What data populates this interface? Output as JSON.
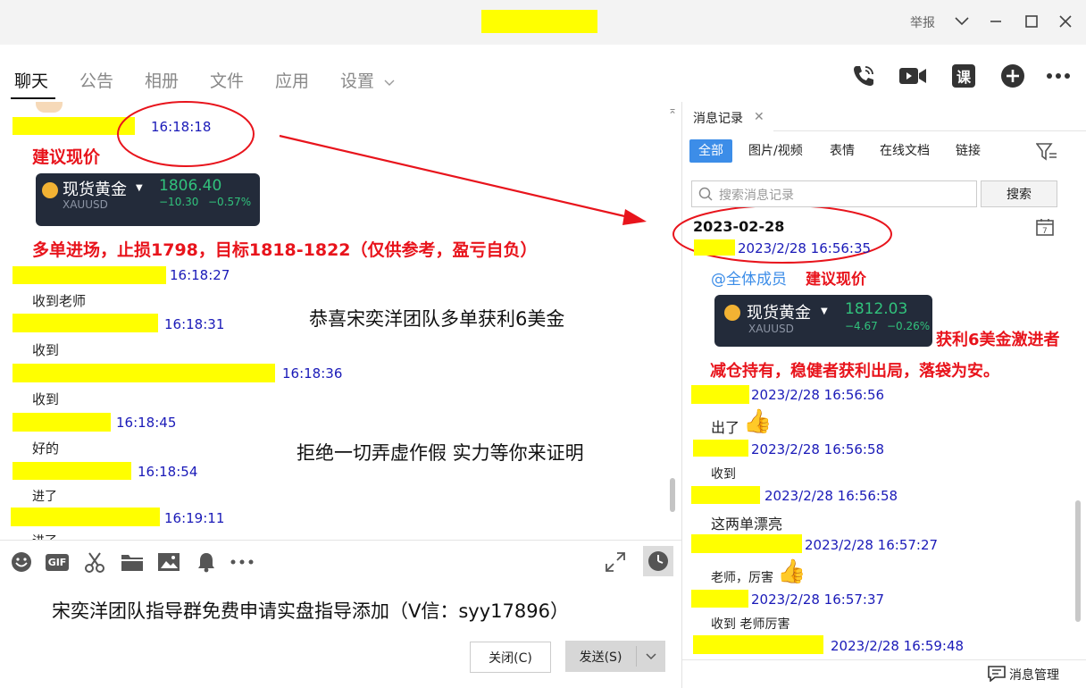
{
  "titlebar": {
    "report_label": "举报"
  },
  "tabs": [
    "聊天",
    "公告",
    "相册",
    "文件",
    "应用",
    "设置"
  ],
  "toolbar_right": {
    "lesson_label": "课"
  },
  "chat": {
    "msgs": [
      {
        "time": "16:18:18"
      },
      {
        "time": "16:18:27",
        "text": "收到老师"
      },
      {
        "time": "16:18:31",
        "text": "收到"
      },
      {
        "time": "16:18:36",
        "text": "收到"
      },
      {
        "time": "16:18:45",
        "text": "好的"
      },
      {
        "time": "16:18:54",
        "text": "进了"
      },
      {
        "time": "16:19:11",
        "text": "进了"
      }
    ],
    "suggest": "建议现价",
    "quote": {
      "name": "现货黄金",
      "price": "1806.40",
      "change": "−10.30",
      "pct": "−0.57%",
      "symbol": "XAUUSD"
    },
    "trade_note": "多单进场，止损1798，目标1818-1822（仅供参考，盈亏自负）",
    "overlay1": "恭喜宋奕洋团队多单获利6美金",
    "overlay2": "拒绝一切弄虚作假 实力等你来证明"
  },
  "composer": {
    "text": "宋奕洋团队指导群免费申请实盘指导添加（V信：syy17896）",
    "close_label": "关闭(C)",
    "send_label": "发送(S)"
  },
  "history": {
    "tab_label": "消息记录",
    "filters": [
      "全部",
      "图片/视频",
      "表情",
      "在线文档",
      "链接"
    ],
    "search_placeholder": "搜索消息记录",
    "search_button": "搜索",
    "date": "2023-02-28",
    "first_time": "2023/2/28 16:56:35",
    "mention": "@全体成员",
    "suggest": "建议现价",
    "quote": {
      "name": "现货黄金",
      "price": "1812.03",
      "change": "−4.67",
      "pct": "−0.26%",
      "symbol": "XAUUSD"
    },
    "profit_note1": "获利6美金激进者",
    "profit_note2": "减仓持有，稳健者获利出局，落袋为安。",
    "entries": [
      {
        "time": "2023/2/28 16:56:56",
        "text": "出了"
      },
      {
        "time": "2023/2/28 16:56:58",
        "text": "收到"
      },
      {
        "time": "2023/2/28 16:56:58",
        "text": "这两单漂亮"
      },
      {
        "time": "2023/2/28 16:57:27",
        "text": "老师，厉害"
      },
      {
        "time": "2023/2/28 16:57:37",
        "text": "收到 老师厉害"
      },
      {
        "time": "2023/2/28 16:59:48"
      }
    ],
    "manage_label": "消息管理"
  },
  "colors": {
    "highlight": "#ffff00",
    "timestamp": "#1a1ab8",
    "annotation": "#e8141c",
    "accent": "#3c8de8",
    "price_up": "#31c27c"
  }
}
